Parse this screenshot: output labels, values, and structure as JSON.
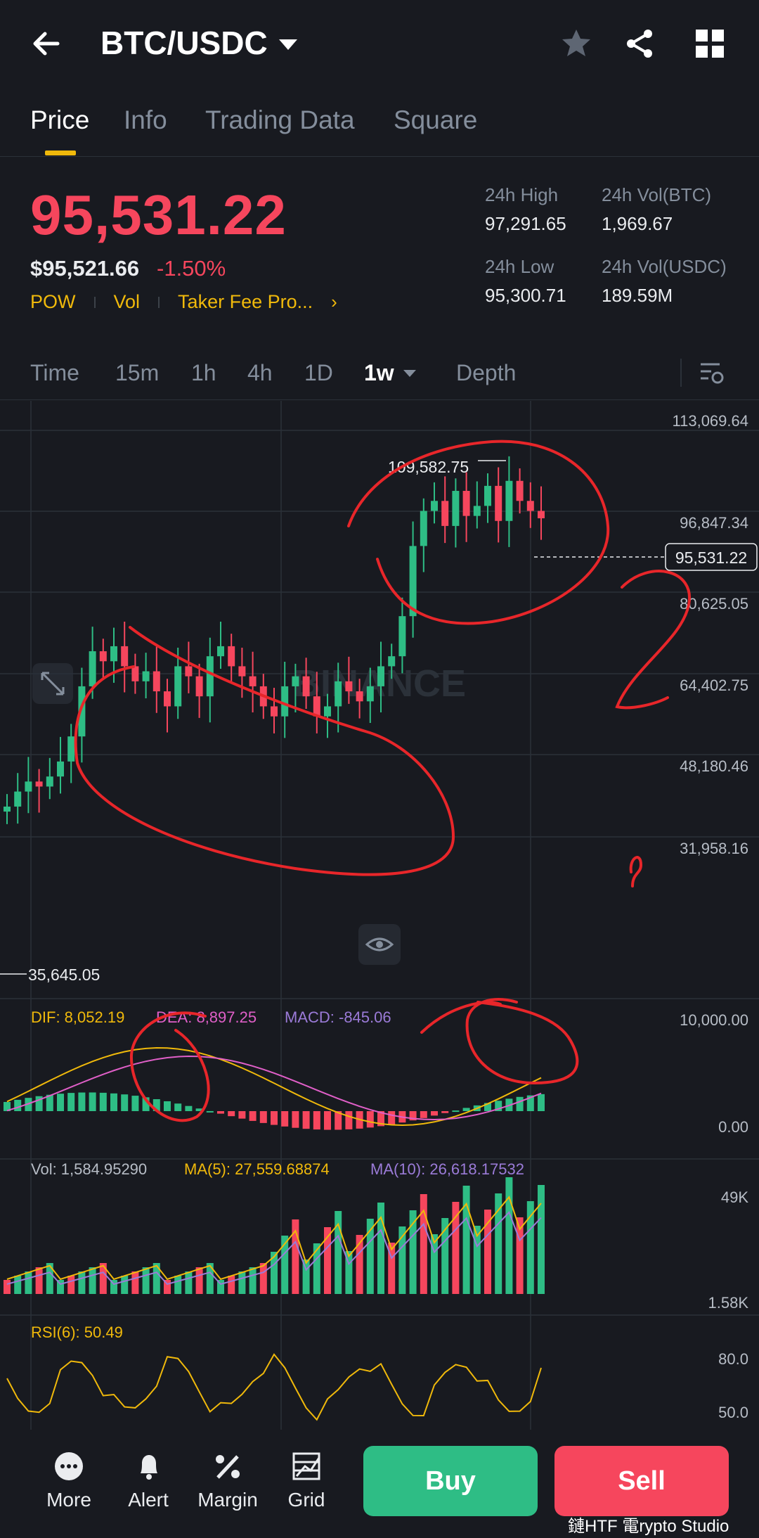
{
  "header": {
    "pair": "BTC/USDC",
    "icons": [
      "back-arrow-icon",
      "star-icon",
      "share-icon",
      "grid-icon"
    ]
  },
  "tabs": [
    {
      "label": "Price",
      "active": true
    },
    {
      "label": "Info",
      "active": false
    },
    {
      "label": "Trading Data",
      "active": false
    },
    {
      "label": "Square",
      "active": false
    }
  ],
  "ticker": {
    "last_price": "95,531.22",
    "usd_price": "$95,521.66",
    "change": "-1.50%",
    "tags": [
      "POW",
      "Vol",
      "Taker Fee Pro..."
    ],
    "high_label": "24h High",
    "high_value": "97,291.65",
    "low_label": "24h Low",
    "low_value": "95,300.71",
    "volbtc_label": "24h Vol(BTC)",
    "volbtc_value": "1,969.67",
    "volusdc_label": "24h Vol(USDC)",
    "volusdc_value": "189.59M"
  },
  "intervals": {
    "items": [
      "Time",
      "15m",
      "1h",
      "4h",
      "1D",
      "1w",
      "Depth"
    ],
    "active": "1w"
  },
  "chart": {
    "watermark": "BINANCE",
    "y_ticks": [
      "113,069.64",
      "96,847.34",
      "80,625.05",
      "64,402.75",
      "48,180.46",
      "31,958.16"
    ],
    "high_marker": "109,582.75",
    "low_marker": "35,645.05",
    "current_price_label": "95,531.22",
    "macd": {
      "dif": "DIF: 8,052.19",
      "dea": "DEA: 8,897.25",
      "macd": "MACD: -845.06",
      "top": "10,000.00",
      "zero": "0.00"
    },
    "vol": {
      "vol": "Vol: 1,584.95290",
      "ma5": "MA(5): 27,559.68874",
      "ma10": "MA(10): 26,618.17532",
      "top": "49K",
      "bottom": "1.58K"
    },
    "rsi": {
      "label": "RSI(6): 50.49",
      "t80": "80.0",
      "t50": "50.0"
    }
  },
  "chart_data": {
    "type": "candlestick",
    "interval": "1w",
    "y_range": [
      31958.16,
      113069.64
    ],
    "note_closes_approx": [
      38000,
      41000,
      43000,
      42000,
      44000,
      47000,
      52000,
      62000,
      69000,
      67000,
      70000,
      66000,
      63000,
      65000,
      61000,
      58000,
      66000,
      64000,
      60000,
      68000,
      70000,
      66000,
      64000,
      62000,
      58000,
      56000,
      62000,
      64000,
      60000,
      56000,
      58000,
      63000,
      61000,
      59000,
      62000,
      66000,
      68000,
      76000,
      90000,
      97000,
      99000,
      94000,
      101000,
      96000,
      98000,
      102000,
      95000,
      103000,
      99000,
      97000,
      95531
    ]
  },
  "bottom": {
    "more": "More",
    "alert": "Alert",
    "margin": "Margin",
    "grid": "Grid",
    "buy": "Buy",
    "sell": "Sell"
  },
  "footer_watermark": "鏈HTF 電rypto Studio",
  "colors": {
    "up": "#2ebd85",
    "down": "#f6465d",
    "accent": "#f0b90b",
    "bg": "#181a20",
    "annotation": "#e8262a"
  }
}
